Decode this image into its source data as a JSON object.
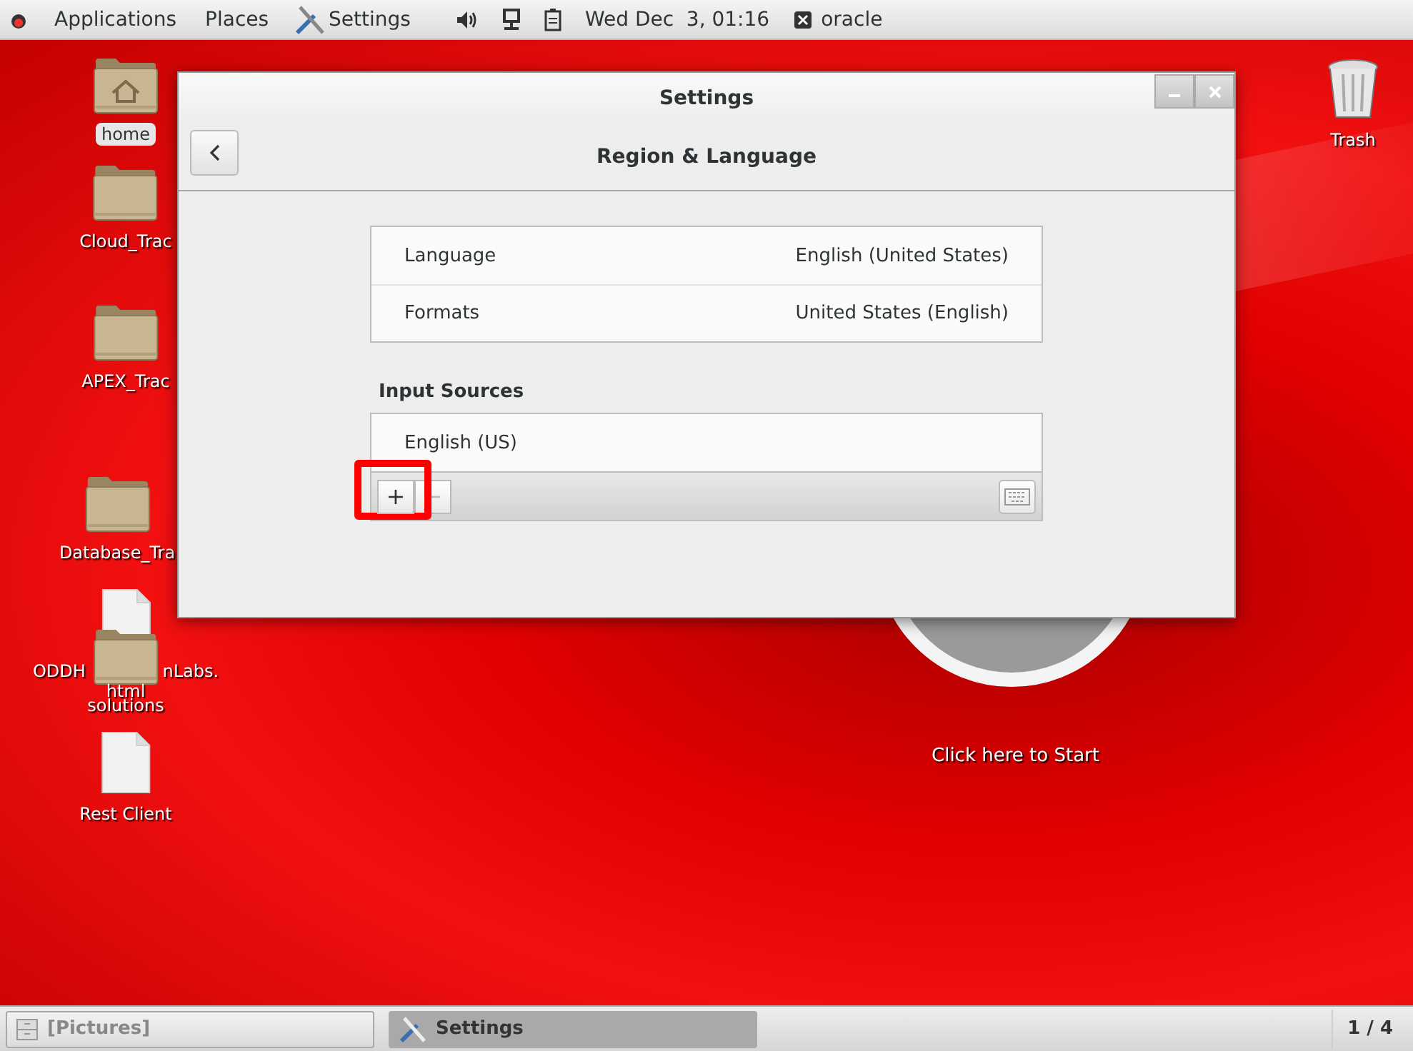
{
  "top_bar": {
    "menus": [
      "Applications",
      "Places"
    ],
    "app": "Settings",
    "clock": "Wed Dec  3, 01:16",
    "user": "oracle"
  },
  "desktop_icons": [
    {
      "label": "home",
      "kind": "home",
      "selected": true
    },
    {
      "label": "Cloud_Trac",
      "kind": "folder",
      "selected": false
    },
    {
      "label": "APEX_Trac",
      "kind": "folder",
      "selected": false
    },
    {
      "label": "Database_Tra",
      "kind": "folder",
      "selected": false
    },
    {
      "label": "ODDH nLabs.",
      "kind": "document",
      "selected": false
    },
    {
      "label": "solutions",
      "kind": "folder",
      "selected": false
    },
    {
      "label": "Rest Client",
      "kind": "document",
      "selected": false
    },
    {
      "label": "Trash",
      "kind": "trash",
      "selected": false
    }
  ],
  "document_suffix": "html",
  "start_label": "Click here to Start",
  "window": {
    "title": "Settings",
    "header": "Region & Language",
    "rows": [
      {
        "label": "Language",
        "value": "English (United States)"
      },
      {
        "label": "Formats",
        "value": "United States (English)"
      }
    ],
    "section": "Input Sources",
    "input_sources": [
      {
        "label": "English (US)"
      }
    ],
    "add_button": {
      "label": "+",
      "highlighted": true
    },
    "remove_button": {
      "label": "−",
      "disabled": true
    }
  },
  "taskbar": {
    "tasks": [
      {
        "label": "[Pictures]",
        "kind": "files",
        "selected": false
      },
      {
        "label": "Settings",
        "kind": "settings",
        "selected": true
      }
    ],
    "workspace": "1 / 4"
  }
}
